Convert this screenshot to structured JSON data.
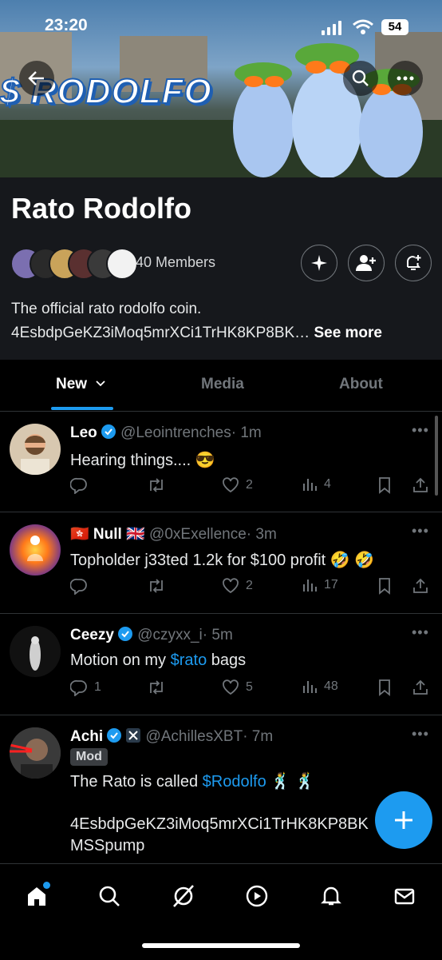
{
  "status_bar": {
    "time": "23:20",
    "battery": "54"
  },
  "banner": {
    "word": "$ RODOLFO"
  },
  "community": {
    "name": "Rato Rodolfo",
    "members": "40 Members",
    "description_line1": "The official rato rodolfo coin.",
    "description_line2": "4EsbdpGeKZ3iMoq5mrXCi1TrHK8KP8BK…",
    "see_more": "See more"
  },
  "tabs": [
    {
      "label": "New"
    },
    {
      "label": "Media"
    },
    {
      "label": "About"
    }
  ],
  "posts": [
    {
      "name": "Leo",
      "handle": "@Leointrenches",
      "time": "· 1m",
      "text": "Hearing things.... 😎",
      "replies": "",
      "likes": "2",
      "views": "4"
    },
    {
      "name": "🇭🇰 Null 🇬🇧",
      "handle": "@0xExellence",
      "time": "· 3m",
      "text": "Topholder j33ted 1.2k for $100 profit 🤣 🤣",
      "replies": "",
      "likes": "2",
      "views": "17"
    },
    {
      "name": "Ceezy",
      "handle": "@czyxx_i",
      "time": "· 5m",
      "text_before": "Motion on my ",
      "link": "$rato",
      "text_after": " bags",
      "replies": "1",
      "likes": "5",
      "views": "48"
    },
    {
      "name": "Achi",
      "handle": "@AchillesXBT",
      "time": "· 7m",
      "badge": "Mod",
      "text_before": "The Rato is called ",
      "link": "$Rodolfo",
      "text_after": " 🕺 🕺",
      "line2": "4EsbdpGeKZ3iMoq5mrXCi1TrHK8KP8BK",
      "line3": "MSSpump"
    }
  ],
  "colors": {
    "accent": "#1d9bf0",
    "background": "#000000",
    "header_bg": "#16181c",
    "muted": "#71767b"
  },
  "icons": [
    "back-icon",
    "search-icon",
    "more-icon",
    "sparkle-icon",
    "add-member-icon",
    "bell-plus-icon",
    "home-icon",
    "explore-icon",
    "grok-icon",
    "video-icon",
    "notifications-icon",
    "messages-icon",
    "compose-icon"
  ]
}
